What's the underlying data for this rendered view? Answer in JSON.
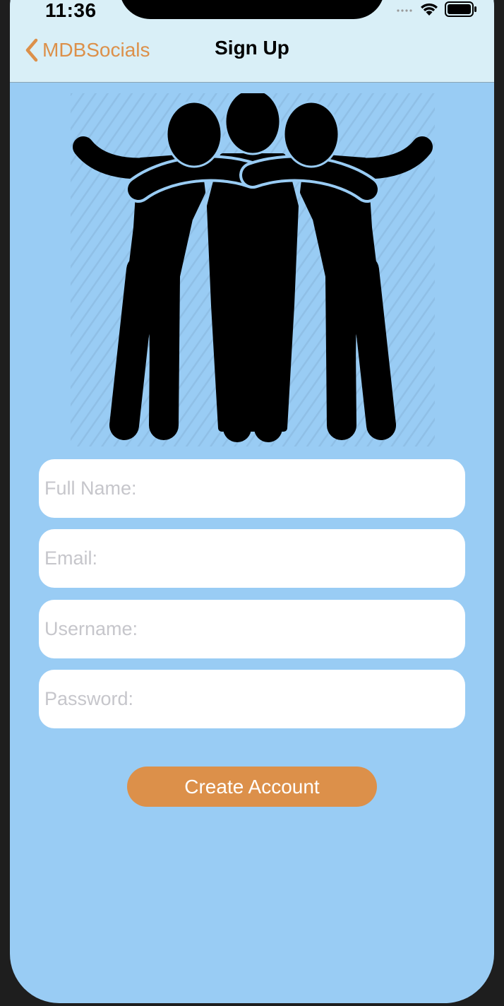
{
  "status_bar": {
    "time": "11:36",
    "signal_icon": "cellular-signal-icon",
    "wifi_icon": "wifi-icon",
    "battery_icon": "battery-icon"
  },
  "nav": {
    "back_label": "MDBSocials",
    "back_icon": "chevron-left-icon",
    "title": "Sign Up"
  },
  "hero": {
    "icon": "three-friends-hugging-icon"
  },
  "form": {
    "full_name": {
      "placeholder": "Full Name:",
      "value": ""
    },
    "email": {
      "placeholder": "Email:",
      "value": ""
    },
    "username": {
      "placeholder": "Username:",
      "value": ""
    },
    "password": {
      "placeholder": "Password:",
      "value": ""
    }
  },
  "actions": {
    "create_account_label": "Create Account"
  },
  "colors": {
    "accent": "#dc904a",
    "background": "#99ccf4",
    "navbar": "#d9eff7",
    "placeholder": "#c6c6cb"
  }
}
